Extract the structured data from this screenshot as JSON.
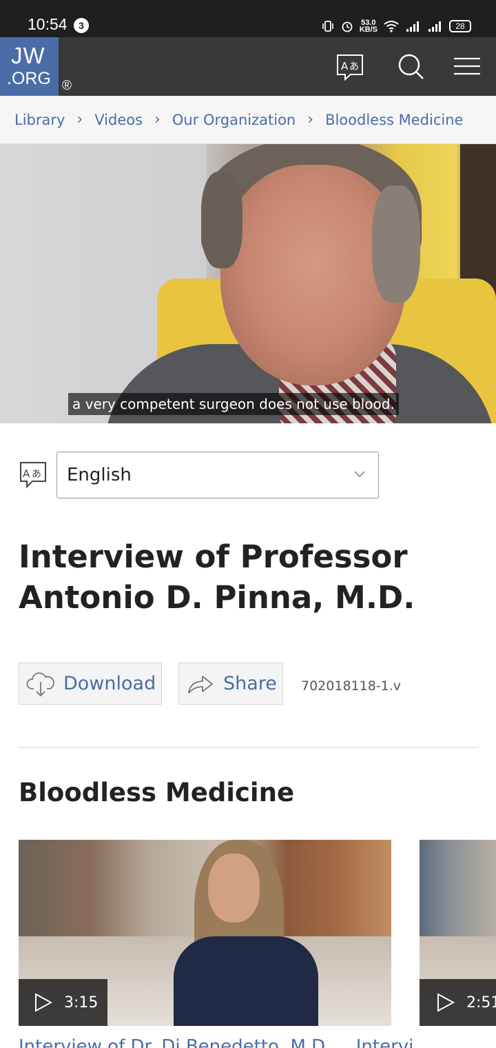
{
  "status_bar": {
    "time": "10:54",
    "notification_count": "3",
    "net_speed_value": "53.0",
    "net_speed_unit": "KB/S",
    "battery": "28"
  },
  "header": {
    "logo_line1": "JW",
    "logo_line2": ".ORG",
    "registered": "®",
    "icons": [
      "language-icon",
      "search-icon",
      "menu-icon"
    ]
  },
  "breadcrumb": [
    "Library",
    "Videos",
    "Our Organization",
    "Bloodless Medicine"
  ],
  "video": {
    "caption": "a very competent surgeon does not use blood."
  },
  "language": {
    "selected": "English"
  },
  "title": "Interview of Professor Antonio D. Pinna, M.D.",
  "actions": {
    "download_label": "Download",
    "share_label": "Share",
    "media_code": "702018118-1.v"
  },
  "section": {
    "title": "Bloodless Medicine",
    "videos": [
      {
        "duration": "3:15",
        "title_peek": "Interview of Dr. Di Benedetto, M.D."
      },
      {
        "duration": "2:51",
        "title_peek": "Intervi"
      }
    ]
  },
  "colors": {
    "brand_blue": "#4a6da7",
    "header_bg": "#3a3839",
    "status_bg": "#1f1f21"
  }
}
